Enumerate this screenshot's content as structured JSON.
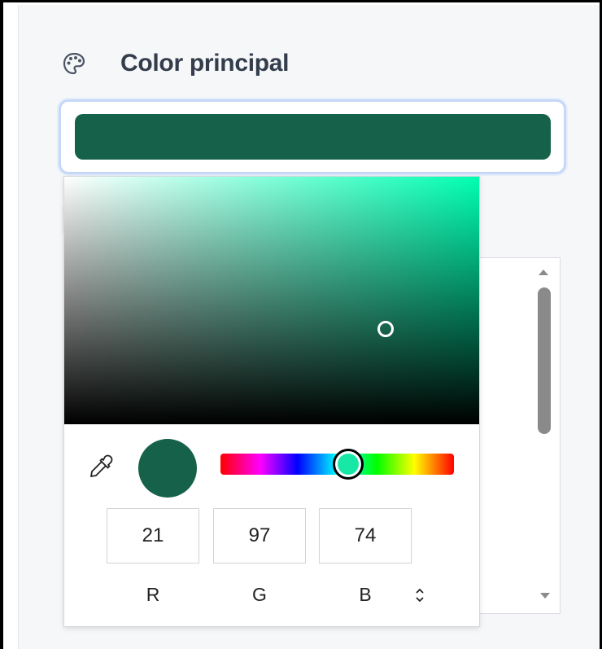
{
  "section": {
    "title": "Color principal",
    "icon": "palette-icon"
  },
  "current_color": {
    "hex": "#15614a",
    "r": "21",
    "g": "97",
    "b": "74"
  },
  "picker": {
    "hue_color": "#00ffb2",
    "hue_thumb_color": "#18e8a6",
    "labels": {
      "r": "R",
      "g": "G",
      "b": "B"
    },
    "icons": [
      "eyedropper-icon",
      "mode-toggle-icon"
    ]
  },
  "colors": {
    "panel_bg": "#f6f7f9",
    "focus_ring": "#c6d8f7",
    "title_text": "#333d4b"
  }
}
